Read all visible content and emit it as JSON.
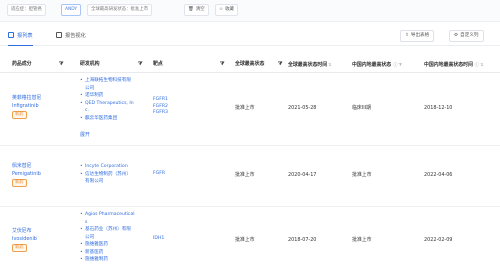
{
  "filters": {
    "target_chip": "适应症：胆管癌",
    "code_chip": "ANDY",
    "status_chip": "全球最高研发状态：批准上市",
    "clear_label": "清空",
    "save_label": "收藏"
  },
  "tabs": [
    {
      "label": "报列表"
    },
    {
      "label": "报告视化"
    }
  ],
  "toolbar": {
    "export_label": "导出表格",
    "custom_label": "自定义列"
  },
  "columns": {
    "drug": "药品成分",
    "org": "研发机构",
    "target": "靶点",
    "global_status": "全球最高状态",
    "global_time": "全球最高状态时间",
    "cn_status": "中国内地最高状态",
    "cn_time": "中国内地最高状态时间"
  },
  "rows": [
    {
      "drug_cn": "英菲格拉替尼",
      "drug_en": "Infigratinib",
      "badge": "新药",
      "orgs": [
        [
          "上海联拓生物科技有限",
          "公司"
        ],
        [
          "诺华制药"
        ],
        [
          "QED Therapeutics, In",
          "c."
        ],
        [
          "麒云华医药集团"
        ]
      ],
      "org_more": "展开",
      "targets": [
        "FGFR1",
        "FGFR2",
        "FGFR3"
      ],
      "global_status": "批准上市",
      "global_time": "2021-05-28",
      "cn_status": "临床III期",
      "cn_time": "2018-12-10"
    },
    {
      "drug_cn": "佩米替尼",
      "drug_en": "Pemigatinib",
      "badge": "新药",
      "orgs": [
        [
          "Incyte Corporation"
        ],
        [
          "信达生物制药（苏州）",
          "有限公司"
        ]
      ],
      "targets": [
        "FGFR"
      ],
      "global_status": "批准上市",
      "global_time": "2020-04-17",
      "cn_status": "批准上市",
      "cn_time": "2022-04-06"
    },
    {
      "drug_cn": "艾伏尼布",
      "drug_en": "Ivosidenib",
      "badge": "新药",
      "orgs": [
        [
          "Agios Pharmaceutical",
          "s"
        ],
        [
          "基石药业（苏州）有限",
          "公司"
        ],
        [
          "施维雅医药"
        ],
        [
          "新基医药"
        ],
        [
          "施维雅制药"
        ]
      ],
      "targets": [
        "IDH1"
      ],
      "global_status": "批准上市",
      "global_time": "2018-07-20",
      "cn_status": "批准上市",
      "cn_time": "2022-02-09"
    }
  ]
}
